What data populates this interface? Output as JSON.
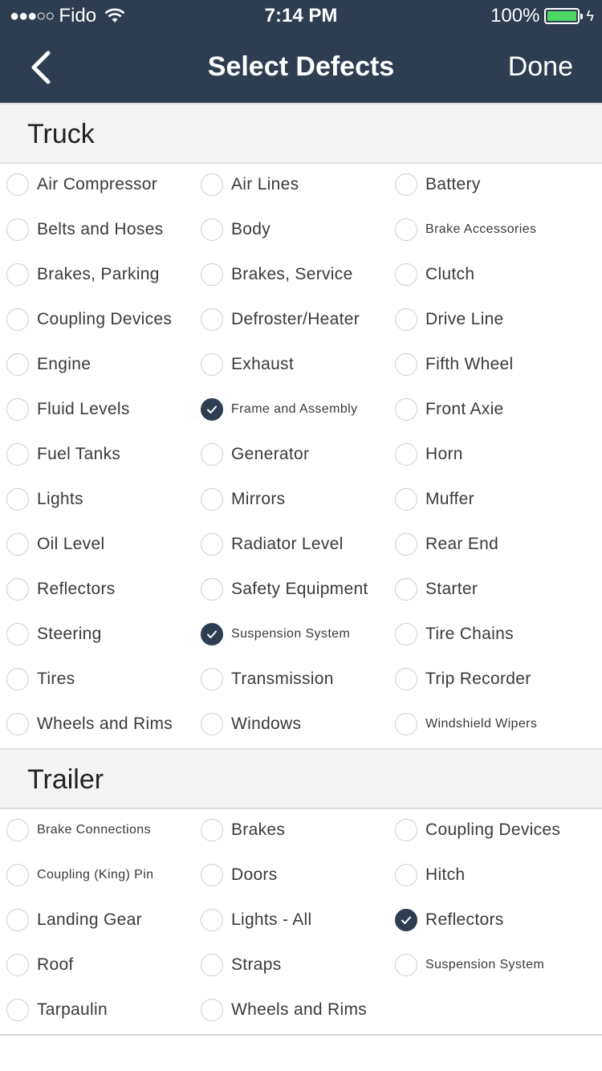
{
  "status_bar": {
    "signal": "●●●○○",
    "carrier": "Fido",
    "time": "7:14 PM",
    "battery": "100%"
  },
  "nav": {
    "title": "Select Defects",
    "done_label": "Done"
  },
  "colors": {
    "header_bg": "#2e3e50",
    "battery_fill": "#4cd964",
    "section_bg": "#f4f4f4"
  },
  "sections": [
    {
      "title": "Truck",
      "items": [
        {
          "label": "Air Compressor",
          "checked": false
        },
        {
          "label": "Air Lines",
          "checked": false
        },
        {
          "label": "Battery",
          "checked": false
        },
        {
          "label": "Belts and Hoses",
          "checked": false
        },
        {
          "label": "Body",
          "checked": false
        },
        {
          "label": "Brake Accessories",
          "checked": false,
          "small": true
        },
        {
          "label": "Brakes, Parking",
          "checked": false
        },
        {
          "label": "Brakes, Service",
          "checked": false
        },
        {
          "label": "Clutch",
          "checked": false
        },
        {
          "label": "Coupling Devices",
          "checked": false
        },
        {
          "label": "Defroster/Heater",
          "checked": false
        },
        {
          "label": "Drive Line",
          "checked": false
        },
        {
          "label": "Engine",
          "checked": false
        },
        {
          "label": "Exhaust",
          "checked": false
        },
        {
          "label": "Fifth Wheel",
          "checked": false
        },
        {
          "label": "Fluid Levels",
          "checked": false
        },
        {
          "label": "Frame and Assembly",
          "checked": true,
          "small": true
        },
        {
          "label": "Front Axie",
          "checked": false
        },
        {
          "label": "Fuel Tanks",
          "checked": false
        },
        {
          "label": "Generator",
          "checked": false
        },
        {
          "label": "Horn",
          "checked": false
        },
        {
          "label": "Lights",
          "checked": false
        },
        {
          "label": "Mirrors",
          "checked": false
        },
        {
          "label": "Muffer",
          "checked": false
        },
        {
          "label": "Oil Level",
          "checked": false
        },
        {
          "label": "Radiator Level",
          "checked": false
        },
        {
          "label": "Rear End",
          "checked": false
        },
        {
          "label": "Reflectors",
          "checked": false
        },
        {
          "label": "Safety Equipment",
          "checked": false
        },
        {
          "label": "Starter",
          "checked": false
        },
        {
          "label": "Steering",
          "checked": false
        },
        {
          "label": "Suspension System",
          "checked": true,
          "small": true
        },
        {
          "label": "Tire Chains",
          "checked": false
        },
        {
          "label": "Tires",
          "checked": false
        },
        {
          "label": "Transmission",
          "checked": false
        },
        {
          "label": "Trip Recorder",
          "checked": false
        },
        {
          "label": "Wheels and Rims",
          "checked": false
        },
        {
          "label": "Windows",
          "checked": false
        },
        {
          "label": "Windshield Wipers",
          "checked": false,
          "small": true
        }
      ]
    },
    {
      "title": "Trailer",
      "items": [
        {
          "label": "Brake Connections",
          "checked": false,
          "small": true
        },
        {
          "label": "Brakes",
          "checked": false
        },
        {
          "label": "Coupling Devices",
          "checked": false
        },
        {
          "label": "Coupling (King) Pin",
          "checked": false,
          "small": true
        },
        {
          "label": "Doors",
          "checked": false
        },
        {
          "label": "Hitch",
          "checked": false
        },
        {
          "label": "Landing Gear",
          "checked": false
        },
        {
          "label": "Lights - All",
          "checked": false
        },
        {
          "label": "Reflectors",
          "checked": true
        },
        {
          "label": "Roof",
          "checked": false
        },
        {
          "label": "Straps",
          "checked": false
        },
        {
          "label": "Suspension System",
          "checked": false,
          "small": true
        },
        {
          "label": "Tarpaulin",
          "checked": false
        },
        {
          "label": "Wheels and Rims",
          "checked": false
        }
      ]
    }
  ]
}
